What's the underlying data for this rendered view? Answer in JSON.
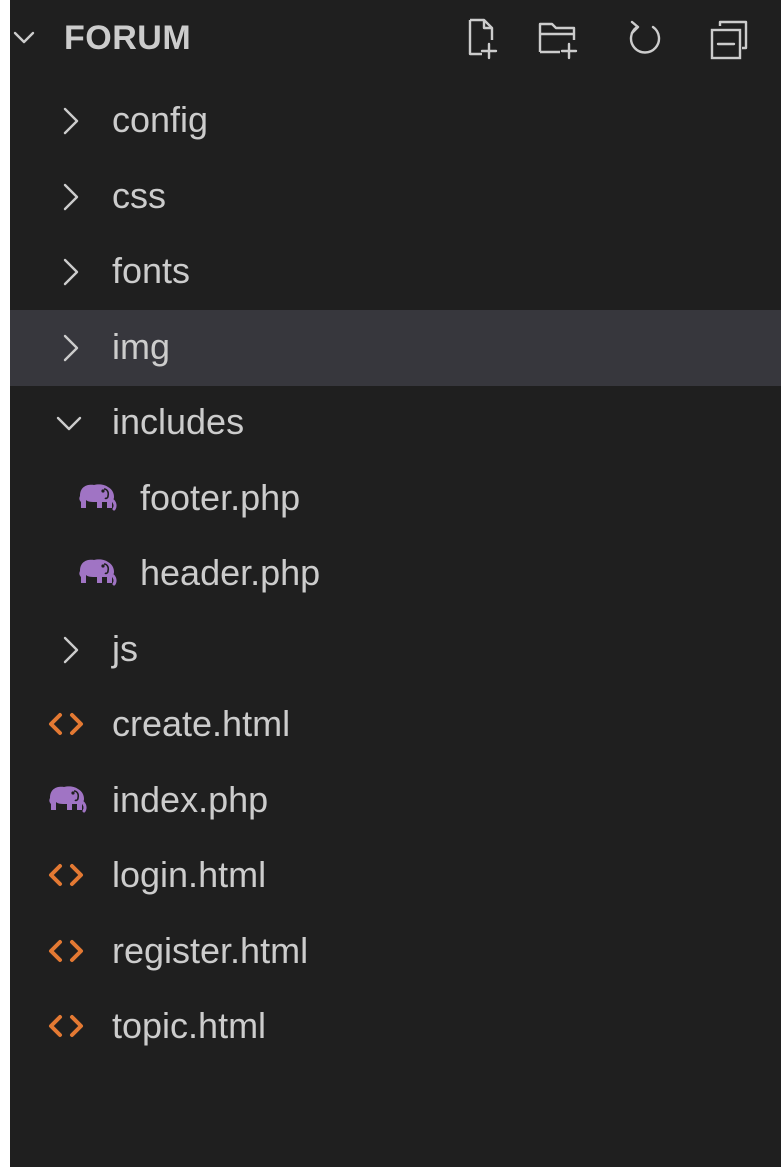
{
  "explorer": {
    "title": "FORUM",
    "actions": [
      {
        "name": "new-file",
        "icon": "new-file-icon"
      },
      {
        "name": "new-folder",
        "icon": "new-folder-icon"
      },
      {
        "name": "refresh",
        "icon": "refresh-icon"
      },
      {
        "name": "collapse-all",
        "icon": "collapse-all-icon"
      }
    ]
  },
  "tree": {
    "items": [
      {
        "label": "config",
        "type": "folder",
        "expanded": false,
        "depth": 1
      },
      {
        "label": "css",
        "type": "folder",
        "expanded": false,
        "depth": 1
      },
      {
        "label": "fonts",
        "type": "folder",
        "expanded": false,
        "depth": 1
      },
      {
        "label": "img",
        "type": "folder",
        "expanded": false,
        "depth": 1,
        "selected": true
      },
      {
        "label": "includes",
        "type": "folder",
        "expanded": true,
        "depth": 1
      },
      {
        "label": "footer.php",
        "type": "php",
        "depth": 2
      },
      {
        "label": "header.php",
        "type": "php",
        "depth": 2
      },
      {
        "label": "js",
        "type": "folder",
        "expanded": false,
        "depth": 1
      },
      {
        "label": "create.html",
        "type": "html",
        "depth": 1
      },
      {
        "label": "index.php",
        "type": "php",
        "depth": 1
      },
      {
        "label": "login.html",
        "type": "html",
        "depth": 1
      },
      {
        "label": "register.html",
        "type": "html",
        "depth": 1
      },
      {
        "label": "topic.html",
        "type": "html",
        "depth": 1
      }
    ]
  },
  "colors": {
    "background": "#1f1f1f",
    "selected_row": "#37373d",
    "text": "#cccccc",
    "php_icon": "#a074c4",
    "html_icon": "#e37933"
  }
}
